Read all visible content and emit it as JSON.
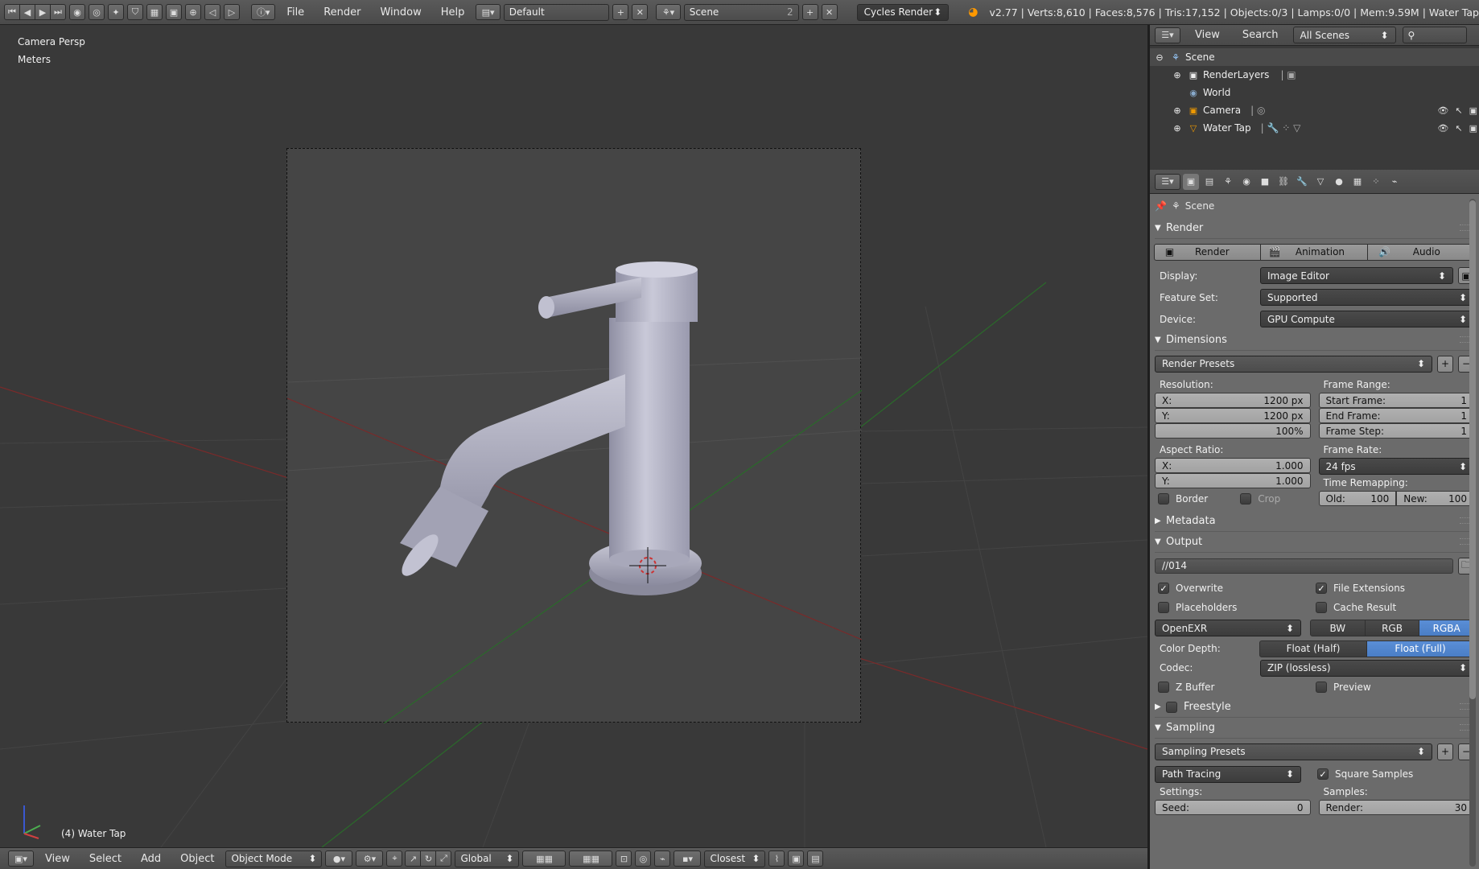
{
  "topbar": {
    "menus": [
      "File",
      "Render",
      "Window",
      "Help"
    ],
    "layout": "Default",
    "scene": "Scene",
    "scene_count": "2",
    "engine": "Cycles Render",
    "stats": "v2.77 | Verts:8,610 | Faces:8,576 | Tris:17,152 | Objects:0/3 | Lamps:0/0 | Mem:9.59M | Water Tap"
  },
  "viewport": {
    "view_name": "Camera Persp",
    "units": "Meters",
    "object_label": "(4) Water Tap"
  },
  "bottombar": {
    "menus": [
      "View",
      "Select",
      "Add",
      "Object"
    ],
    "mode": "Object Mode",
    "orientation": "Global",
    "snap": "Closest"
  },
  "outliner": {
    "header_view": "View",
    "header_search": "Search",
    "filter": "All Scenes",
    "items": [
      {
        "label": "Scene"
      },
      {
        "label": "RenderLayers"
      },
      {
        "label": "World"
      },
      {
        "label": "Camera"
      },
      {
        "label": "Water Tap"
      }
    ]
  },
  "properties": {
    "context": "Scene",
    "render": {
      "title": "Render",
      "render_btn": "Render",
      "animation_btn": "Animation",
      "audio_btn": "Audio",
      "display_label": "Display:",
      "display_value": "Image Editor",
      "feature_label": "Feature Set:",
      "feature_value": "Supported",
      "device_label": "Device:",
      "device_value": "GPU Compute"
    },
    "dimensions": {
      "title": "Dimensions",
      "presets": "Render Presets",
      "resolution_label": "Resolution:",
      "res_x_label": "X:",
      "res_x": "1200 px",
      "res_y_label": "Y:",
      "res_y": "1200 px",
      "res_pct": "100%",
      "frame_range_label": "Frame Range:",
      "start_label": "Start Frame:",
      "start": "1",
      "end_label": "End Frame:",
      "end": "1",
      "step_label": "Frame Step:",
      "step": "1",
      "aspect_label": "Aspect Ratio:",
      "asp_x_label": "X:",
      "asp_x": "1.000",
      "asp_y_label": "Y:",
      "asp_y": "1.000",
      "frame_rate_label": "Frame Rate:",
      "frame_rate": "24 fps",
      "time_remap_label": "Time Remapping:",
      "old_label": "Old:",
      "old": "100",
      "new_label": "New:",
      "new": "100",
      "border": "Border",
      "crop": "Crop"
    },
    "metadata": {
      "title": "Metadata"
    },
    "output": {
      "title": "Output",
      "path": "//014",
      "overwrite": "Overwrite",
      "file_ext": "File Extensions",
      "placeholders": "Placeholders",
      "cache": "Cache Result",
      "format": "OpenEXR",
      "bw": "BW",
      "rgb": "RGB",
      "rgba": "RGBA",
      "color_depth_label": "Color Depth:",
      "half": "Float (Half)",
      "full": "Float (Full)",
      "codec_label": "Codec:",
      "codec": "ZIP (lossless)",
      "zbuffer": "Z Buffer",
      "preview": "Preview"
    },
    "freestyle": {
      "title": "Freestyle"
    },
    "sampling": {
      "title": "Sampling",
      "presets": "Sampling Presets",
      "method": "Path Tracing",
      "square": "Square Samples",
      "settings_label": "Settings:",
      "samples_label": "Samples:",
      "seed_label": "Seed:",
      "seed": "0",
      "render_label": "Render:",
      "render": "30"
    }
  }
}
